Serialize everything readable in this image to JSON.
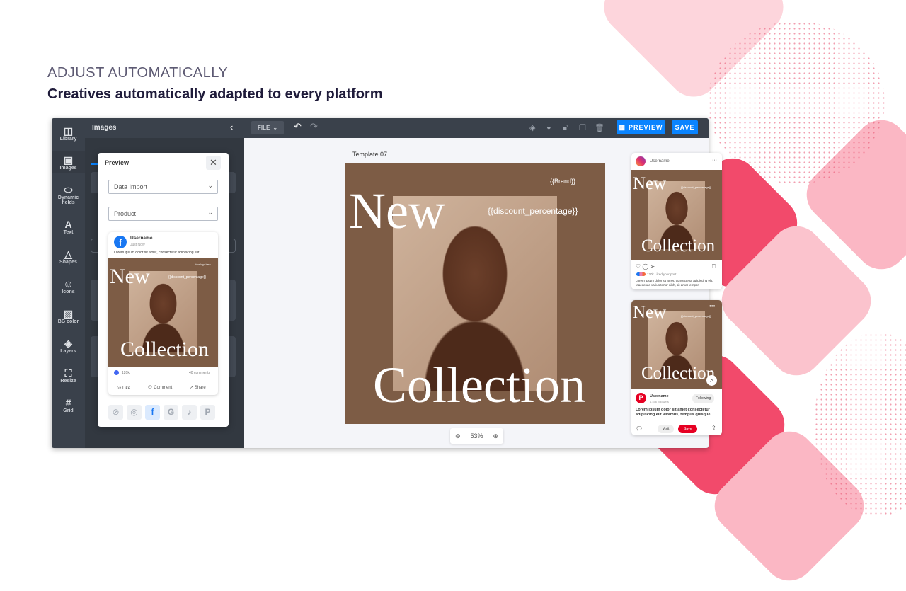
{
  "heading": {
    "eyebrow": "ADJUST AUTOMATICALLY",
    "title": "Creatives automatically adapted to every platform"
  },
  "colors": {
    "accent": "#0a84ff",
    "brand_pink": "#f04868",
    "brown": "#7d5c45",
    "toolbar": "#3a414b"
  },
  "sidebar": {
    "items": [
      {
        "label": "Library",
        "icon": "library-icon",
        "glyph": "◫"
      },
      {
        "label": "Images",
        "icon": "image-icon",
        "glyph": "▣"
      },
      {
        "label": "Dynamic fields",
        "icon": "tag-icon",
        "glyph": "⬭"
      },
      {
        "label": "Text",
        "icon": "text-icon",
        "glyph": "A"
      },
      {
        "label": "Shapes",
        "icon": "shapes-icon",
        "glyph": "△"
      },
      {
        "label": "Icons",
        "icon": "smiley-icon",
        "glyph": "☺"
      },
      {
        "label": "BG color",
        "icon": "pattern-icon",
        "glyph": "▨"
      },
      {
        "label": "Layers",
        "icon": "layers-icon",
        "glyph": "◈"
      },
      {
        "label": "Resize",
        "icon": "resize-icon",
        "glyph": "⛶"
      },
      {
        "label": "Grid",
        "icon": "grid-icon",
        "glyph": "#"
      }
    ]
  },
  "panel": {
    "title": "Images"
  },
  "toolbar": {
    "file": "FILE",
    "preview": "PREVIEW",
    "save": "SAVE"
  },
  "preview_modal": {
    "title": "Preview",
    "select1": "Data Import",
    "select2": "Product",
    "post": {
      "username": "Username",
      "time": "Just Now",
      "text": "Lorem ipsum dolor sit amet, consectetur adipiscing elit.",
      "likes": "120k",
      "comments": "40 comments",
      "like": "Like",
      "comment": "Comment",
      "share": "Share"
    },
    "platforms": [
      "compass",
      "instagram",
      "facebook",
      "google",
      "tiktok",
      "pinterest"
    ],
    "active_platform": "facebook"
  },
  "canvas": {
    "template_name": "Template 07",
    "brand": "{{Brand}}",
    "discount": "{{discount_percentage}}",
    "word1": "New",
    "word2": "Collection",
    "logo": "Your logo here",
    "zoom": "53%"
  },
  "instagram": {
    "username": "Username",
    "likes": "120k Liked your post",
    "caption": "Lorem ipsum dolor sit amet, consectetur adipiscing elit. Maecenas varius tortor nibh, sit amet tempor"
  },
  "pinterest": {
    "username": "Username",
    "followers": "1,456 followers",
    "following": "Following",
    "caption": "Lorem ipsum dolor sit amet consectetur adipiscing elit vivamus, tempus quisque",
    "visit": "Visit",
    "save": "Save"
  }
}
